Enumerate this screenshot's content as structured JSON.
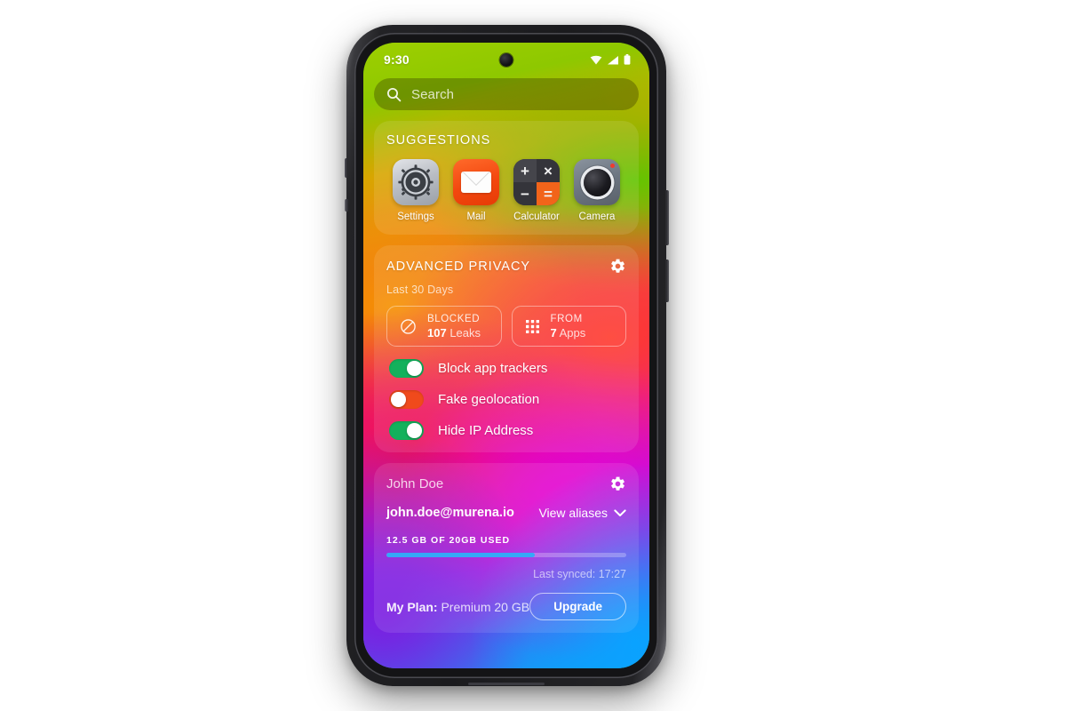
{
  "status_bar": {
    "time": "9:30",
    "icons": [
      "wifi-icon",
      "cellular-signal-icon",
      "battery-icon"
    ]
  },
  "search": {
    "placeholder": "Search",
    "icon": "search-icon"
  },
  "suggestions": {
    "title": "SUGGESTIONS",
    "apps": [
      {
        "label": "Settings",
        "icon": "settings-app-icon"
      },
      {
        "label": "Mail",
        "icon": "mail-app-icon"
      },
      {
        "label": "Calculator",
        "icon": "calculator-app-icon"
      },
      {
        "label": "Camera",
        "icon": "camera-app-icon"
      }
    ],
    "calculator_keys": {
      "plus": "+",
      "times": "×",
      "minus": "−",
      "equals": "="
    }
  },
  "advanced_privacy": {
    "title": "ADVANCED PRIVACY",
    "settings_icon": "gear-icon",
    "period": "Last 30 Days",
    "stats": [
      {
        "caption": "BLOCKED",
        "value": "107",
        "unit": "Leaks",
        "icon": "block-circle-slash-icon"
      },
      {
        "caption": "FROM",
        "value": "7",
        "unit": "Apps",
        "icon": "apps-grid-icon"
      }
    ],
    "toggles": [
      {
        "label": "Block app trackers",
        "state": "on"
      },
      {
        "label": "Fake geolocation",
        "state": "off"
      },
      {
        "label": "Hide IP Address",
        "state": "on"
      }
    ]
  },
  "account": {
    "name": "John Doe",
    "settings_icon": "gear-icon",
    "email": "john.doe@murena.io",
    "aliases_label": "View aliases",
    "aliases_icon": "chevron-down-icon",
    "usage_caption": "12.5 GB OF 20GB USED",
    "usage_percent": 62,
    "last_synced": "Last synced: 17:27",
    "plan_label": "My Plan:",
    "plan_value": "Premium 20 GB",
    "upgrade_label": "Upgrade"
  },
  "colors": {
    "toggle_on": "#13b15c",
    "toggle_off": "#f04a1c",
    "progress_fill": "#35a8f7",
    "mail_accent": "#f3470f",
    "calculator_accent": "#f2641a"
  }
}
